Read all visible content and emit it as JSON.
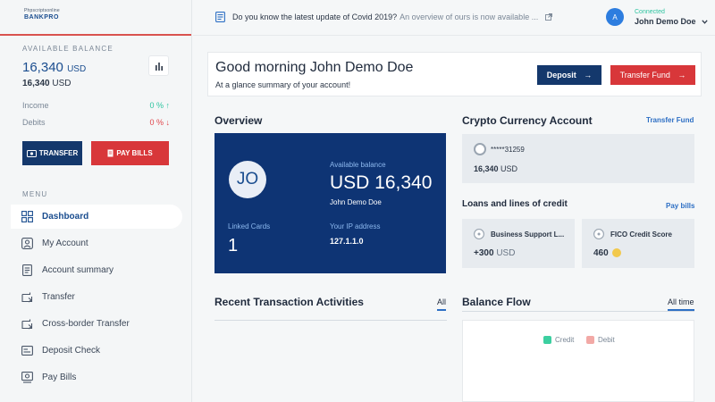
{
  "brand": {
    "small": "Phpscriptsonline",
    "big": "BANKPRO"
  },
  "sidebar": {
    "balance_label": "AVAILABLE BALANCE",
    "balance_value": "16,340",
    "balance_currency": "USD",
    "balance_sub_value": "16,340",
    "balance_sub_currency": "USD",
    "income_label": "Income",
    "income_value": "0 %",
    "debits_label": "Debits",
    "debits_value": "0 %",
    "transfer_label": "TRANSFER",
    "pay_bills_label": "PAY BILLS",
    "menu_label": "MENU",
    "items": [
      {
        "label": "Dashboard",
        "icon": "grid-icon"
      },
      {
        "label": "My Account",
        "icon": "user-icon"
      },
      {
        "label": "Account summary",
        "icon": "document-icon"
      },
      {
        "label": "Transfer",
        "icon": "transfer-icon"
      },
      {
        "label": "Cross-border Transfer",
        "icon": "globe-transfer-icon"
      },
      {
        "label": "Deposit Check",
        "icon": "check-icon"
      },
      {
        "label": "Pay Bills",
        "icon": "bill-icon"
      }
    ]
  },
  "topbar": {
    "news_title": "Do you know the latest update of Covid 2019?",
    "news_sub": "An overview of ours is now available ...",
    "user_initial": "A",
    "user_status": "Connected",
    "user_name": "John Demo Doe"
  },
  "greeting": {
    "title": "Good morning John Demo Doe",
    "subtitle": "At a glance summary of your account!",
    "deposit_label": "Deposit",
    "transfer_fund_label": "Transfer Fund"
  },
  "overview": {
    "title": "Overview",
    "initials": "JO",
    "available_label": "Available balance",
    "available_value": "USD 16,340",
    "name": "John Demo Doe",
    "linked_cards_label": "Linked Cards",
    "linked_cards_value": "1",
    "ip_label": "Your IP address",
    "ip_value": "127.1.1.0"
  },
  "crypto": {
    "title": "Crypto Currency Account",
    "link": "Transfer Fund",
    "account_id": "*****31259",
    "balance": "16,340",
    "currency": "USD"
  },
  "loans": {
    "title": "Loans and lines of credit",
    "link": "Pay bills",
    "card1_title": "Business Support L...",
    "card1_value": "+300",
    "card1_currency": "USD",
    "card2_title": "FICO Credit Score",
    "card2_value": "460"
  },
  "recent": {
    "title": "Recent Transaction Activities",
    "tab": "All"
  },
  "flow": {
    "title": "Balance Flow",
    "tab": "All time",
    "legend_credit": "Credit",
    "legend_debit": "Debit",
    "credit_color": "#3ccfa0",
    "debit_color": "#f2a9a6"
  },
  "colors": {
    "navy": "#0e3474",
    "red": "#d8373a",
    "accent_blue": "#2d6fc4",
    "green": "#2ec4a0"
  }
}
